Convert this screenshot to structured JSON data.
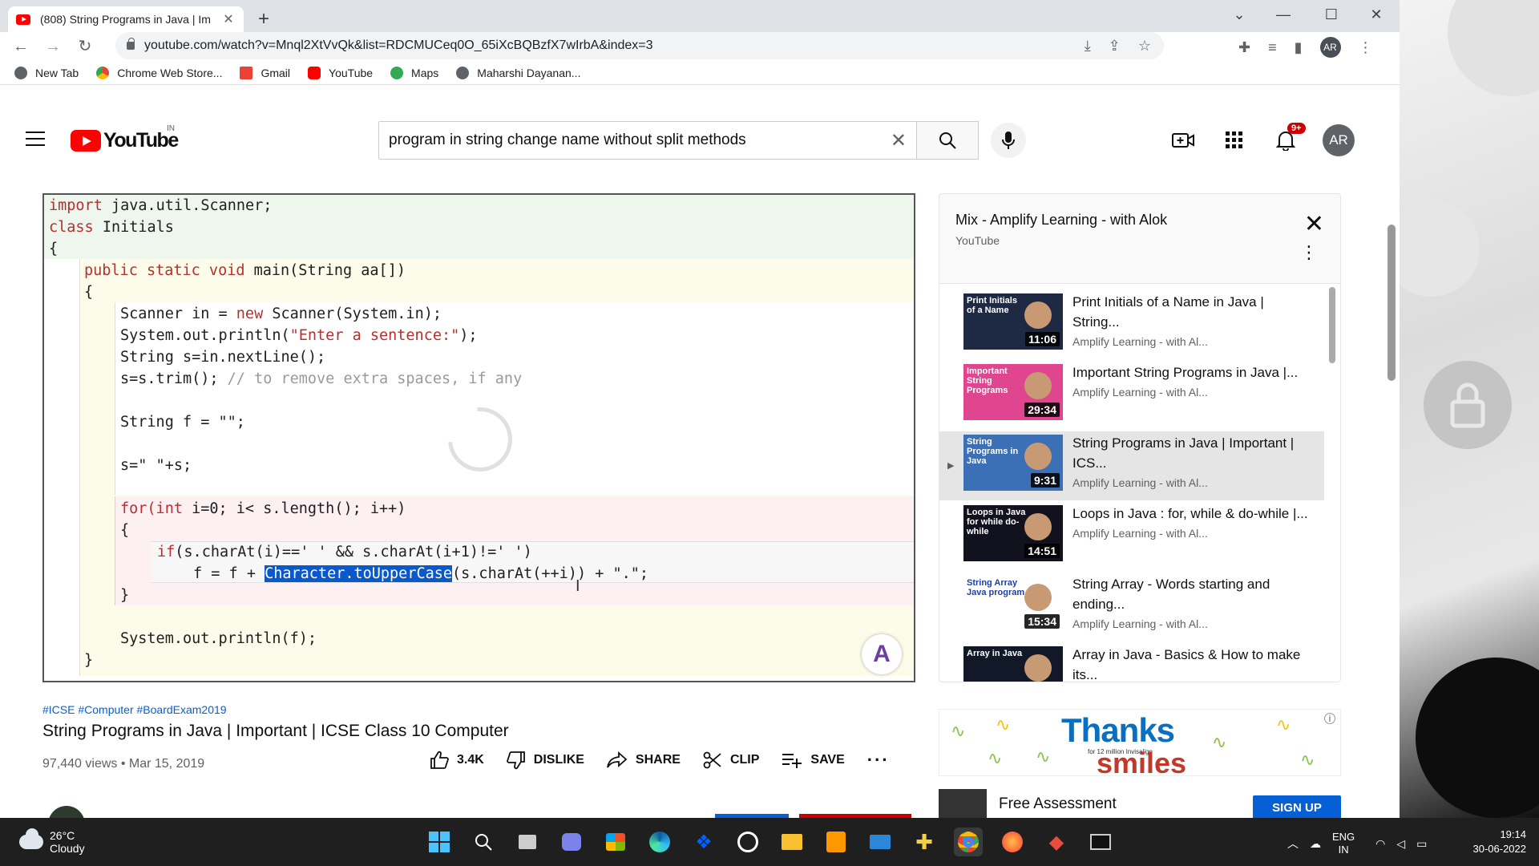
{
  "browser": {
    "tab_title": "(808) String Programs in Java | Im",
    "url": "youtube.com/watch?v=Mnql2XtVvQk&list=RDCMUCeq0O_65iXcBQBzfX7wIrbA&index=3",
    "profile_initials": "AR",
    "bookmarks": [
      "New Tab",
      "Chrome Web Store...",
      "Gmail",
      "YouTube",
      "Maps",
      "Maharshi Dayanan..."
    ]
  },
  "youtube": {
    "logo_text": "YouTube",
    "region": "IN",
    "search_query": "program in string change name without split methods",
    "notifications_badge": "9+",
    "avatar_initials": "AR"
  },
  "video": {
    "code_lines": {
      "l1_kw": "import",
      "l1": " java.util.Scanner;",
      "l2_kw": "class",
      "l2": " Initials",
      "l3": "{",
      "l4_kw": "public static void",
      "l4": " main(String aa[])",
      "l5": "{",
      "l6a": "Scanner in = ",
      "l6_kw": "new",
      "l6b": " Scanner(System.in);",
      "l7a": "System.out.println(",
      "l7_str": "\"Enter a sentence:\"",
      "l7b": ");",
      "l8": "String s=in.nextLine();",
      "l9a": "s=s.trim(); ",
      "l9_cm": "// to remove extra spaces, if any",
      "l10": "String f = \"\";",
      "l11": "s=\" \"+s;",
      "l12_kw": "for(int",
      "l12": " i=0; i< s.length(); i++)",
      "l13": "{",
      "l14_kw": "if",
      "l14": "(s.charAt(i)==' ' && s.charAt(i+1)!=' ')",
      "l15a": "f = f + ",
      "l15_hl": "Character.toUpperCase",
      "l15b": "(s.charAt(++i)) + \".\";",
      "l16": "}",
      "l17": "System.out.println(f);",
      "l18": "}"
    },
    "hashtags": "#ICSE #Computer #BoardExam2019",
    "title": "String Programs in Java | Important | ICSE Class 10 Computer",
    "meta": "97,440 views • Mar 15, 2019",
    "actions": {
      "likes": "3.4K",
      "dislike": "DISLIKE",
      "share": "SHARE",
      "clip": "CLIP",
      "save": "SAVE"
    }
  },
  "playlist": {
    "title": "Mix - Amplify Learning - with Alok",
    "subtitle": "YouTube",
    "items": [
      {
        "title": "Print Initials of a Name in Java | String...",
        "channel": "Amplify Learning - with Al...",
        "duration": "11:06",
        "thumb_text": "Print Initials of a Name",
        "thumb_color": "#1e2a44",
        "active": false
      },
      {
        "title": "Important String Programs in Java |...",
        "channel": "Amplify Learning - with Al...",
        "duration": "29:34",
        "thumb_text": "Important String Programs",
        "thumb_color": "#e0458f",
        "active": false
      },
      {
        "title": "String Programs in Java | Important | ICS...",
        "channel": "Amplify Learning - with Al...",
        "duration": "9:31",
        "thumb_text": "String Programs in Java",
        "thumb_color": "#3b6fb6",
        "active": true
      },
      {
        "title": "Loops in Java : for, while & do-while |...",
        "channel": "Amplify Learning - with Al...",
        "duration": "14:51",
        "thumb_text": "Loops in Java for while do-while",
        "thumb_color": "#12121e",
        "active": false
      },
      {
        "title": "String Array - Words starting and ending...",
        "channel": "Amplify Learning - with Al...",
        "duration": "15:34",
        "thumb_text": "String Array Java program",
        "thumb_color": "#ffffff",
        "active": false
      },
      {
        "title": "Array in Java - Basics & How to make its...",
        "channel": "",
        "duration": "",
        "thumb_text": "Array in Java",
        "thumb_color": "#111827",
        "active": false
      }
    ]
  },
  "ads": {
    "banner_main": "Thanks",
    "banner_small": "for 12 million Invisalign",
    "banner_sub": "smiles",
    "promo_text": "Free Assessment",
    "promo_button": "SIGN UP"
  },
  "taskbar": {
    "temperature": "26°C",
    "condition": "Cloudy",
    "lang_top": "ENG",
    "lang_bottom": "IN",
    "time": "19:14",
    "date": "30-06-2022"
  }
}
